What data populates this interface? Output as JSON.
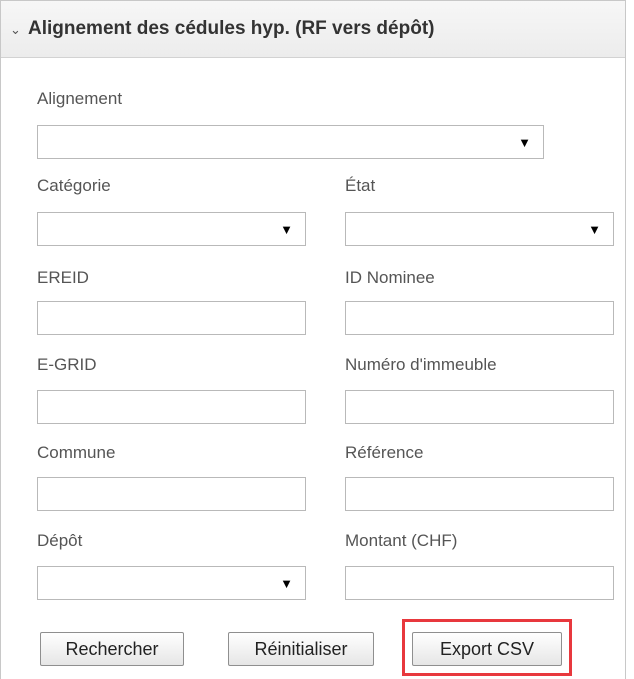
{
  "panel": {
    "title": "Alignement des cédules hyp. (RF vers dépôt)",
    "collapse_icon": "chevron-down-icon"
  },
  "form": {
    "alignement": {
      "label": "Alignement",
      "value": ""
    },
    "categorie": {
      "label": "Catégorie",
      "value": ""
    },
    "etat": {
      "label": "État",
      "value": ""
    },
    "ereid": {
      "label": "EREID",
      "value": ""
    },
    "id_nominee": {
      "label": "ID Nominee",
      "value": ""
    },
    "egrid": {
      "label": "E-GRID",
      "value": ""
    },
    "numero_immeuble": {
      "label": "Numéro d'immeuble",
      "value": ""
    },
    "commune": {
      "label": "Commune",
      "value": ""
    },
    "reference": {
      "label": "Référence",
      "value": ""
    },
    "depot": {
      "label": "Dépôt",
      "value": ""
    },
    "montant": {
      "label": "Montant (CHF)",
      "value": ""
    }
  },
  "buttons": {
    "search": "Rechercher",
    "reset": "Réinitialiser",
    "export": "Export CSV"
  },
  "dropdown_glyph": "▼",
  "highlight_color": "#e8383d"
}
